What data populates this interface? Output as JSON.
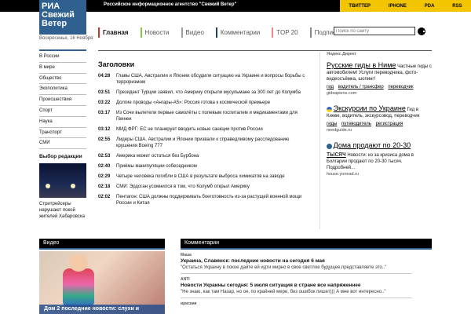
{
  "header": {
    "agency": "Российское информационное агентство \"Свежий Ветер\"",
    "top_links": [
      "ТВИТТЕР",
      "IPHONE",
      "PDA",
      "RSS"
    ]
  },
  "logo": {
    "line1": "РИА",
    "line2": "Свежий",
    "line3": "Ветер"
  },
  "date": "Воскресенье, 16 Ноября",
  "nav": {
    "tabs": [
      {
        "label": "Главная",
        "color": "#c0392b"
      },
      {
        "label": "Новости",
        "color": "#8bc34a"
      },
      {
        "label": "Видео",
        "color": "#a0a0a0"
      },
      {
        "label": "Комментарии",
        "color": "#1e3f66"
      },
      {
        "label": "TOP 20",
        "color": "#e88"
      },
      {
        "label": "Подписка",
        "color": "#888"
      }
    ]
  },
  "search": {
    "placeholder": "Поиск по сайту"
  },
  "sidebar": {
    "items": [
      "В России",
      "В мире",
      "Общество",
      "Экополитика",
      "Происшествия",
      "Спорт",
      "Наука",
      "Транспорт",
      "СМИ"
    ]
  },
  "editor": {
    "title": "Выбор редакции",
    "caption": "Стритрейсеры нарушают покой жителей Хабаровска"
  },
  "headlines": {
    "title": "Заголовки",
    "items": [
      {
        "time": "04:28",
        "text": "Главы США, Австралии и Японии обсудили ситуацию на Украине и вопросы борьбы с терроризмом"
      },
      {
        "time": "03:51",
        "text": "Президент Турции заявил, что Америку открыли мусульмане за 300 лет до Колумба"
      },
      {
        "time": "03:22",
        "text": "Долгие проводы «Ангары-А5»: Россия готова к космической премьере"
      },
      {
        "time": "03:17",
        "text": "Из Сочи вылетели первые самолёты с полевым госпиталем и медикаментами для Гвинеи"
      },
      {
        "time": "03:12",
        "text": "МИД ФРГ: ЕС не планирует вводить новые санкции против России"
      },
      {
        "time": "02:55",
        "text": "Лидеры США, Австралии и Японии призвали к справедливому расследованию крушения Boeing 777"
      },
      {
        "time": "02:53",
        "text": "Америка может остаться без Бурбона"
      },
      {
        "time": "02:40",
        "text": "Приёмы манипуляции собеседником"
      },
      {
        "time": "02:29",
        "text": "Четыре человека погибли в США в результате выброса химикатов на заводе"
      },
      {
        "time": "02:18",
        "text": "СМИ: Эрдоган усомнился в том, что Колумб открыл Америку"
      },
      {
        "time": "02:02",
        "text": "Пентагон: США должны поддерживать боеготовность из-за растущей военной мощи России и Китая"
      }
    ]
  },
  "ads": {
    "label": "Яндекс.Директ",
    "items": [
      {
        "title": "Русские гиды в Ниме",
        "text": "Частные гиды с автомобилем! Услуги переводчика, фото- видеосъёмка, шопинг!",
        "links": [
          "гид",
          "водитель / трансфер",
          "переводчик"
        ],
        "domain": "gidsapiens.com"
      },
      {
        "title": "Экскурсии по Украине",
        "text": "Гид в Киеве, водитель, экскурсовод, переводчик",
        "links": [
          "гиды",
          "путеводитель",
          "регистрация"
        ],
        "domain": "needguide.ru"
      },
      {
        "title": "Дома продают по 20-30 тысяч",
        "text": "Новости: из за кризиса дома в Болгарии продают по 20-30 тысяч. Подробней...",
        "links": [],
        "domain": "house.yonead.ru"
      }
    ]
  },
  "video": {
    "heading": "Видео",
    "caption": "Дом 2 последние новости: слухи и"
  },
  "comments": {
    "heading": "Комментарии",
    "items": [
      {
        "author": "Маша",
        "title": "Украина, Славянск: последние новости на сегодня 6 мая",
        "text": "\"Остаться Украину в покое дайте ей идти мирно в свое светлое будущее,представляете это..\""
      },
      {
        "author": "ANTI",
        "title": "Новости Украины сегодня: 5 июля ситуация в стране все напряженнее",
        "text": "\"Не знаю, как там Назар, но он, по крайней мере, без ошибок пишет))) А мне вот интересно..\""
      },
      {
        "author": "ириския",
        "title": "",
        "text": ""
      }
    ]
  }
}
